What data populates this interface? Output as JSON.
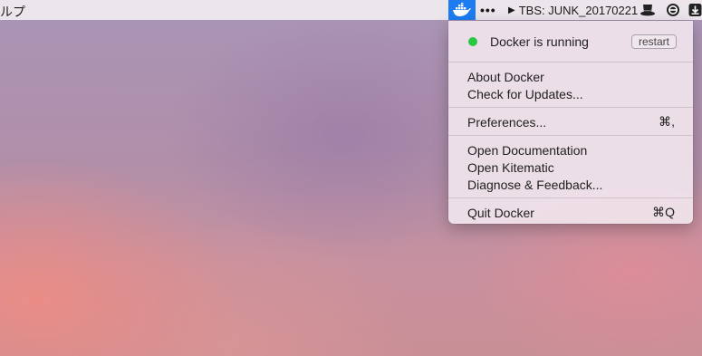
{
  "menubar": {
    "app_fragment": "ルプ",
    "dots": "•••",
    "tbs_label": "TBS: JUNK_20170221",
    "play_glyph": "▶",
    "icons": [
      "docker-whale-icon",
      "top-hat-icon",
      "circle-logo-icon",
      "download-icon"
    ],
    "docker_highlight_color": "#1d7cf2"
  },
  "menu": {
    "status_text": "Docker is running",
    "status_color": "#28c940",
    "restart_label": "restart",
    "about": "About Docker",
    "check_updates": "Check for Updates...",
    "preferences": "Preferences...",
    "preferences_shortcut": "⌘,",
    "open_documentation": "Open Documentation",
    "open_kitematic": "Open Kitematic",
    "diagnose": "Diagnose & Feedback...",
    "quit": "Quit Docker",
    "quit_shortcut": "⌘Q"
  }
}
